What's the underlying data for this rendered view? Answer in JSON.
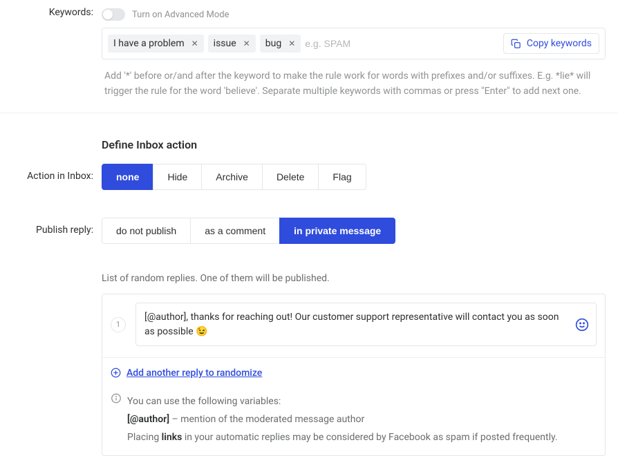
{
  "keywords": {
    "label": "Keywords:",
    "advancedToggleLabel": "Turn on Advanced Mode",
    "tags": [
      "I have a problem",
      "issue",
      "bug"
    ],
    "placeholder": "e.g. SPAM",
    "copyLabel": "Copy keywords",
    "hint": "Add '*' before or/and after the keyword to make the rule work for words with prefixes and/or suffixes. E.g. *lie* will trigger the rule for the word 'believe'. Separate multiple keywords with commas or press \"Enter\" to add next one."
  },
  "inboxAction": {
    "title": "Define Inbox action",
    "label": "Action in Inbox:",
    "options": [
      "none",
      "Hide",
      "Archive",
      "Delete",
      "Flag"
    ],
    "selected": "none"
  },
  "publishReply": {
    "label": "Publish reply:",
    "options": [
      "do not publish",
      "as a comment",
      "in private message"
    ],
    "selected": "in private message"
  },
  "replies": {
    "intro": "List of random replies. One of them will be published.",
    "items": [
      {
        "num": "1",
        "text": "[@author], thanks for reaching out! Our customer support representative will contact you as soon as possible 😉"
      }
    ],
    "addLabel": "Add another reply to randomize",
    "info": {
      "line1": "You can use the following variables:",
      "authorTag": "[@author]",
      "authorDesc": " – mention of the moderated message author",
      "linksPrefix": "Placing ",
      "linksBold": "links",
      "linksSuffix": " in your automatic replies may be considered by Facebook as spam if posted frequently."
    }
  }
}
